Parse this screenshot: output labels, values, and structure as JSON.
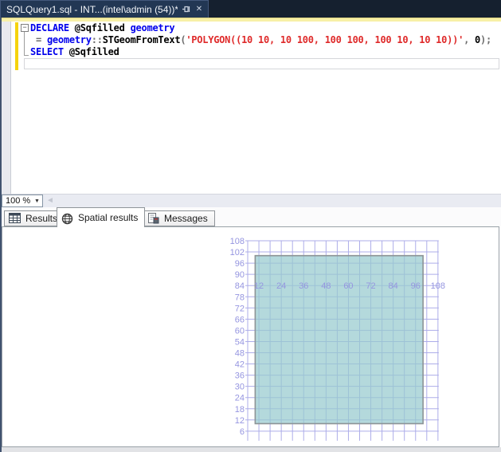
{
  "window": {
    "doc_tab": {
      "title": "SQLQuery1.sql - INT...(intel\\admin (54))*",
      "close_glyph": "✕"
    }
  },
  "editor": {
    "fold_glyph": "−",
    "lines": [
      [
        {
          "t": "DECLARE",
          "c": "kw"
        },
        {
          "t": " @Sqfilled ",
          "c": "plain"
        },
        {
          "t": "geometry",
          "c": "kw"
        }
      ],
      [
        {
          "t": " = ",
          "c": "op"
        },
        {
          "t": "geometry",
          "c": "kw"
        },
        {
          "t": "::",
          "c": "op"
        },
        {
          "t": "STGeomFromText",
          "c": "plain"
        },
        {
          "t": "(",
          "c": "op"
        },
        {
          "t": "'POLYGON((10 10, 10 100, 100 100, 100 10, 10 10))'",
          "c": "str"
        },
        {
          "t": ", ",
          "c": "op"
        },
        {
          "t": "0",
          "c": "plain"
        },
        {
          "t": ");",
          "c": "op"
        }
      ],
      [
        {
          "t": "SELECT",
          "c": "kw"
        },
        {
          "t": " @Sqfilled",
          "c": "plain"
        }
      ],
      []
    ]
  },
  "zoom_control": {
    "value": "100 %",
    "arrow_glyph": "▼",
    "scroll_left_glyph": "◄"
  },
  "result_tabs": [
    {
      "label": "Results",
      "icon": "results-grid-icon",
      "selected": false
    },
    {
      "label": "Spatial results",
      "icon": "globe-icon",
      "selected": true
    },
    {
      "label": "Messages",
      "icon": "messages-icon",
      "selected": false
    }
  ],
  "chart_data": {
    "type": "area",
    "title": "Spatial results viewport",
    "x_range": [
      6,
      108
    ],
    "y_range": [
      6,
      108
    ],
    "grid_step": 6,
    "x_tick_labels": [
      12,
      24,
      36,
      48,
      60,
      72,
      84,
      96,
      108
    ],
    "y_tick_labels": [
      108,
      102,
      96,
      90,
      84,
      78,
      72,
      66,
      60,
      54,
      48,
      42,
      36,
      30,
      24,
      18,
      12,
      6
    ],
    "x_label_row_at_y": 84,
    "polygon": [
      [
        10,
        10
      ],
      [
        10,
        100
      ],
      [
        100,
        100
      ],
      [
        100,
        10
      ],
      [
        10,
        10
      ]
    ],
    "colors": {
      "grid": "#adade9",
      "tick_label": "#9595e0",
      "polygon_fill": "rgba(151,203,206,0.72)",
      "polygon_stroke": "#8d9496"
    }
  }
}
